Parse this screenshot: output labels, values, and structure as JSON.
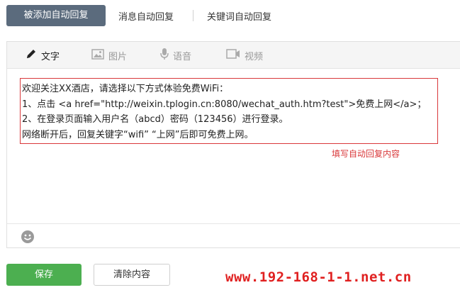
{
  "top_tabs": {
    "active": "被添加自动回复",
    "message": "消息自动回复",
    "keyword": "关键词自动回复"
  },
  "media_bar": {
    "text": "文字",
    "image": "图片",
    "voice": "语音",
    "video": "视频"
  },
  "editor": {
    "lines": [
      "欢迎关注XX酒店，请选择以下方式体验免费WiFi：",
      "1、点击 <a href=\"http://weixin.tplogin.cn:8080/wechat_auth.htm?test\">免费上网</a>；",
      "2、在登录页面输入用户名（abcd）密码（123456）进行登录。",
      "网络断开后，回复关键字“wifi” “上网”后即可免费上网。"
    ],
    "hint": "填写自动回复内容"
  },
  "buttons": {
    "save": "保存",
    "clear": "清除内容"
  },
  "watermark": "www.192-168-1-1.net.cn",
  "colors": {
    "active_tab": "#5b6b7d",
    "save_button": "#4caf50",
    "highlight_red": "#d9383a"
  },
  "icons": [
    "pencil-icon",
    "image-icon",
    "microphone-icon",
    "video-icon",
    "emoji-icon"
  ]
}
